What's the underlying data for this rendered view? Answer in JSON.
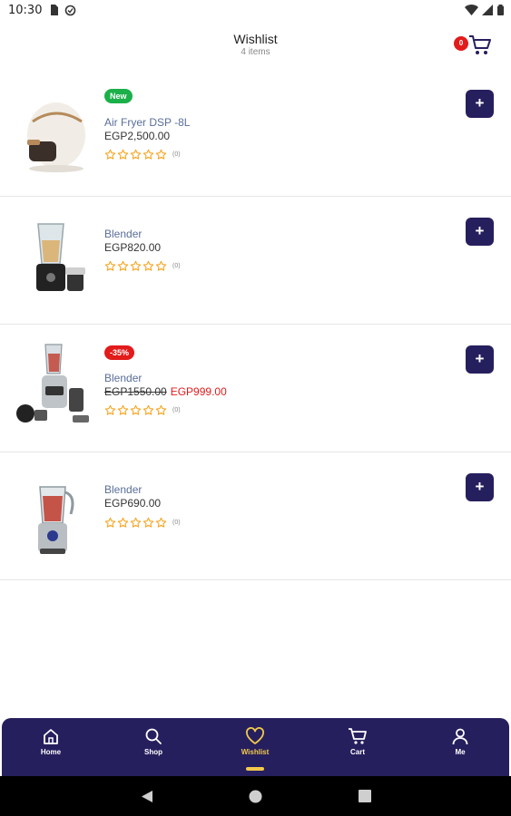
{
  "status_bar": {
    "time": "10:30"
  },
  "header": {
    "title": "Wishlist",
    "subtitle": "4 items",
    "cart_count": "0"
  },
  "products": [
    {
      "badge": "New",
      "name": "Air Fryer DSP -8L",
      "price": "EGP2,500.00",
      "old_price": "",
      "new_price": "",
      "rating": 0,
      "rating_count": "(0)"
    },
    {
      "badge": "",
      "name": "Blender",
      "price": "EGP820.00",
      "old_price": "",
      "new_price": "",
      "rating": 0,
      "rating_count": "(0)"
    },
    {
      "badge": "-35%",
      "name": "Blender",
      "price": "",
      "old_price": "EGP1550.00",
      "new_price": "EGP999.00",
      "rating": 0,
      "rating_count": "(0)"
    },
    {
      "badge": "",
      "name": "Blender",
      "price": "EGP690.00",
      "old_price": "",
      "new_price": "",
      "rating": 0,
      "rating_count": "(0)"
    }
  ],
  "add_label": "+",
  "bottom_nav": {
    "items": [
      {
        "label": "Home",
        "icon": "home-icon"
      },
      {
        "label": "Shop",
        "icon": "search-icon"
      },
      {
        "label": "Wishlist",
        "icon": "heart-icon"
      },
      {
        "label": "Cart",
        "icon": "cart-icon"
      },
      {
        "label": "Me",
        "icon": "user-icon"
      }
    ],
    "active": "Wishlist"
  },
  "colors": {
    "primary": "#261f5e",
    "accent": "#f2c94c",
    "sale": "#e21b1b",
    "new": "#1bb04a",
    "star": "#f5a623"
  }
}
